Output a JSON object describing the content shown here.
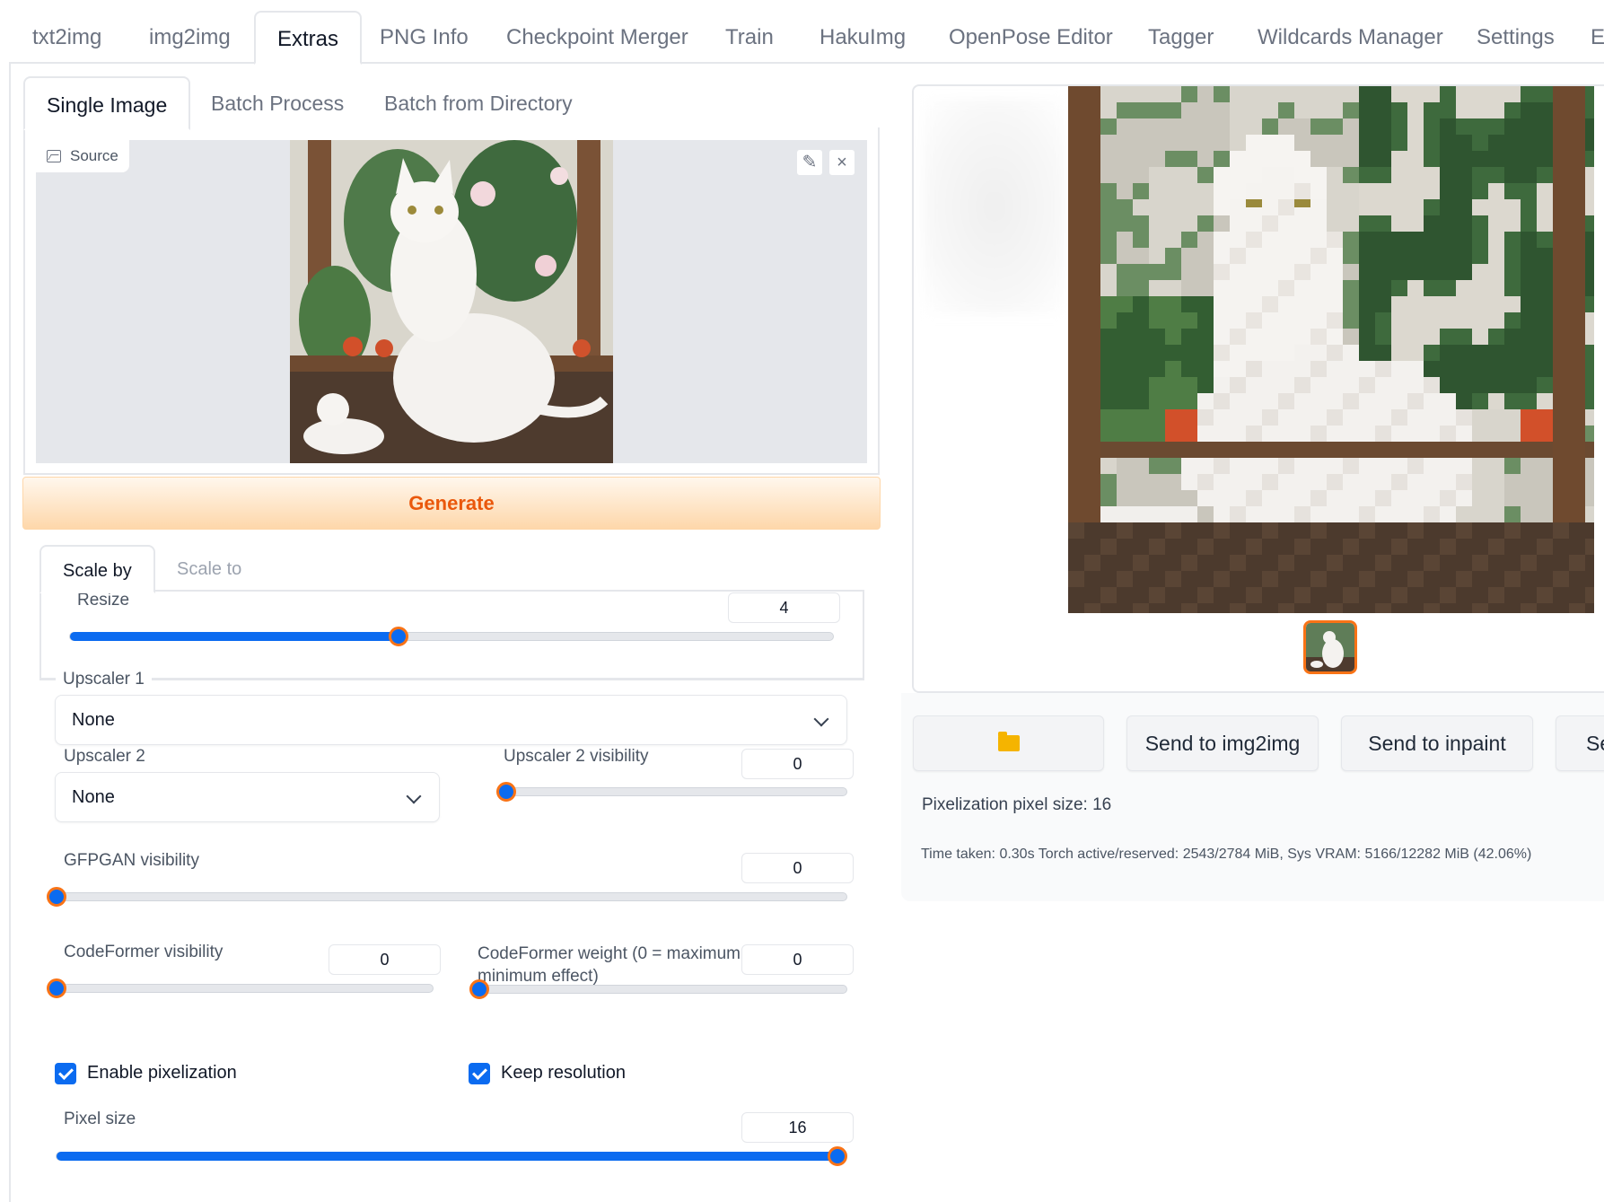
{
  "top_tabs": [
    {
      "label": "txt2img"
    },
    {
      "label": "img2img"
    },
    {
      "label": "Extras"
    },
    {
      "label": "PNG Info"
    },
    {
      "label": "Checkpoint Merger"
    },
    {
      "label": "Train"
    },
    {
      "label": "HakuImg"
    },
    {
      "label": "OpenPose Editor"
    },
    {
      "label": "Tagger"
    },
    {
      "label": "Wildcards Manager"
    },
    {
      "label": "Settings"
    },
    {
      "label": "E"
    }
  ],
  "sub_tabs": [
    {
      "label": "Single Image"
    },
    {
      "label": "Batch Process"
    },
    {
      "label": "Batch from Directory"
    }
  ],
  "source": {
    "label": "Source",
    "edit_icon": "pencil-icon",
    "close_icon": "close-icon"
  },
  "generate_label": "Generate",
  "scale_tabs": [
    {
      "label": "Scale by"
    },
    {
      "label": "Scale to"
    }
  ],
  "resize": {
    "label": "Resize",
    "value": "4",
    "fraction": 0.43
  },
  "upscaler1": {
    "label": "Upscaler 1",
    "value": "None"
  },
  "upscaler2": {
    "label": "Upscaler 2",
    "value": "None"
  },
  "upscaler2_visibility": {
    "label": "Upscaler 2 visibility",
    "value": "0",
    "fraction": 0
  },
  "gfpgan": {
    "label": "GFPGAN visibility",
    "value": "0",
    "fraction": 0
  },
  "codeformer_visibility": {
    "label": "CodeFormer visibility",
    "value": "0",
    "fraction": 0
  },
  "codeformer_weight": {
    "label_line1": "CodeFormer weight (0 = maximum",
    "label_line2": "minimum effect)",
    "value": "0",
    "fraction": 0
  },
  "enable_pixelization": {
    "label": "Enable pixelization",
    "checked": true
  },
  "keep_resolution": {
    "label": "Keep resolution",
    "checked": true
  },
  "pixel_size": {
    "label": "Pixel size",
    "value": "16",
    "fraction": 1.0
  },
  "actions": {
    "open_folder_icon": "folder-icon",
    "send_img2img": "Send to img2img",
    "send_inpaint": "Send to inpaint",
    "send_extras": "Se"
  },
  "output_info": "Pixelization pixel size: 16",
  "timing": "Time taken: 0.30s  Torch active/reserved: 2543/2784 MiB, Sys VRAM: 5166/12282 MiB (42.06%)",
  "colors": {
    "accent": "#0b6bf0",
    "generate_text": "#ea580c",
    "thumb_border": "#f97316"
  }
}
